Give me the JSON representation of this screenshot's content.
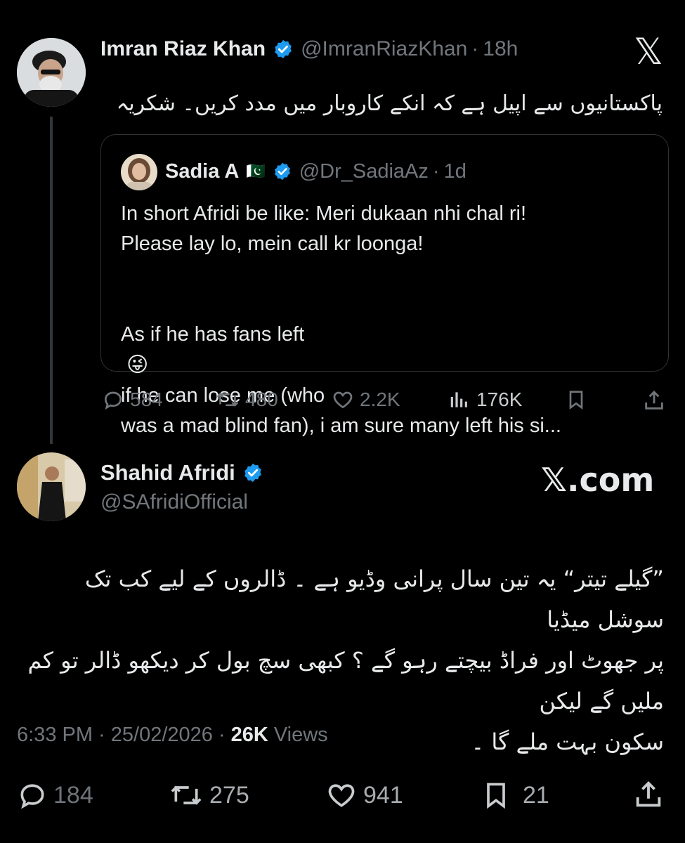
{
  "tweet1": {
    "name": "Imran Riaz Khan",
    "handle": "@ImranRiazKhan",
    "sep": "·",
    "time": "18h",
    "text": "پاکستانیوں سے اپیل ہے کہ انکے کاروبار میں مدد کریں۔ شکریہ",
    "x_logo": "𝕏",
    "quote": {
      "name": "Sadia A",
      "flag": "🇵🇰",
      "handle": "@Dr_SadiaAz",
      "sep": "·",
      "time": "1d",
      "line1": "In short Afridi be like: Meri dukaan nhi chal ri!",
      "line2": "Please lay lo, mein call kr loonga!",
      "line3a": "As if he has fans left",
      "emoji": "😜",
      "line3b": "if he can lose me (who",
      "line4": "was a mad blind fan), i am sure many left his si..."
    },
    "actions": {
      "replies": "584",
      "retweets": "480",
      "likes": "2.2K",
      "views": "176K"
    }
  },
  "tweet2": {
    "name": "Shahid Afridi",
    "handle": "@SAfridiOfficial",
    "watermark": "𝕏.com",
    "text_line1": "”گیلے تیتر“ یہ تین سال پرانی وڈیو ہے ۔ ڈالروں کے لیے کب تک سوشل میڈیا",
    "text_line2": "پر جھوٹ اور فراڈ بیچتے رہو گے ؟ کبھی سچ بول کر دیکھو ڈالر تو کم ملیں گے لیکن",
    "text_line3": "سکون بہت ملے گا ۔",
    "timestamp": "6:33 PM · 25/02/2026 ·",
    "views_count": "26K",
    "views_label": "Views",
    "actions": {
      "replies": "184",
      "retweets": "275",
      "likes": "941",
      "bookmarks": "21"
    }
  },
  "colors": {
    "background": "#000000",
    "text": "#e7e9ea",
    "muted": "#71767b",
    "verified": "#1d9bf0",
    "border": "#2f3336"
  }
}
